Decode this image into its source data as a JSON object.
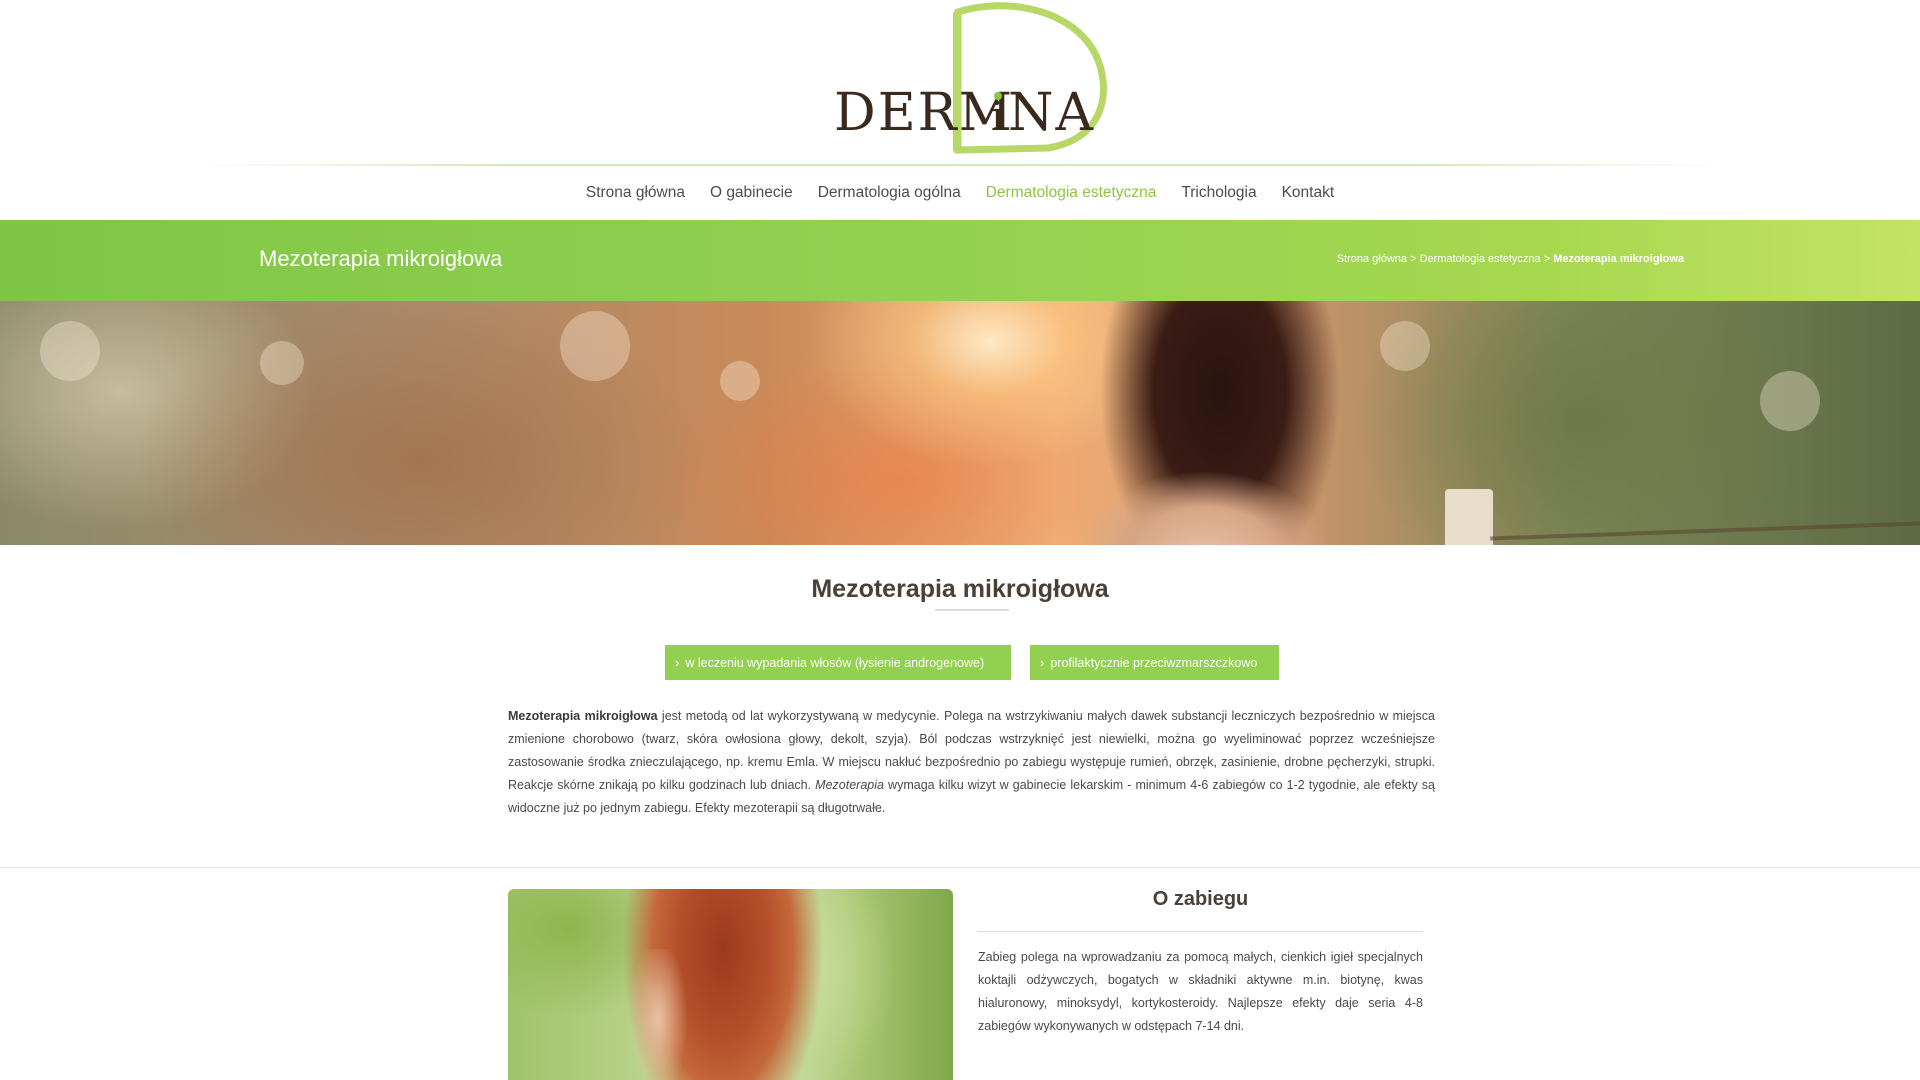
{
  "brand": {
    "logo_text": "DERMiNA",
    "accent_color": "#92d050",
    "text_color": "#3a2a1e"
  },
  "nav": {
    "items": [
      {
        "label": "Strona główna",
        "active": false
      },
      {
        "label": "O gabinecie",
        "active": false
      },
      {
        "label": "Dermatologia ogólna",
        "active": false
      },
      {
        "label": "Dermatologia estetyczna",
        "active": true
      },
      {
        "label": "Trichologia",
        "active": false
      },
      {
        "label": "Kontakt",
        "active": false
      }
    ]
  },
  "banner": {
    "title": "Mezoterapia mikroigłowa",
    "breadcrumb": {
      "home": "Strona główna",
      "separator1": " > ",
      "parent": "Dermatologia estetyczna",
      "separator2": " > ",
      "current": "Mezoterapia mikroigłowa"
    }
  },
  "main": {
    "title": "Mezoterapia mikroigłowa",
    "buttons": [
      {
        "label": "w leczeniu wypadania włosów (łysienie androgenowe)",
        "icon": "chevron-right-icon"
      },
      {
        "label": "profilaktycznie przeciwzmarszczkowo",
        "icon": "chevron-right-icon"
      }
    ],
    "intro": {
      "bold": "Mezoterapia mikroigłowa",
      "part1": " jest metodą od lat wykorzystywaną w medycynie. Polega na wstrzykiwaniu małych dawek substancji leczniczych bezpośrednio w miejsca zmienione chorobowo (twarz, skóra owłosiona głowy, dekolt, szyja). Ból podczas wstrzyknięć jest niewielki, można go wyeliminować poprzez wcześniejsze zastosowanie środka znieczulającego, np. kremu Emla. W miejscu nakłuć bezpośrednio po zabiegu występuje rumień, obrzęk, zasinienie, drobne pęcherzyki, strupki. Reakcje skórne znikają po kilku godzinach lub dniach. ",
      "italic": "Mezoterapia",
      "part2": " wymaga kilku wizyt w gabinecie lekarskim - minimum 4-6 zabiegów co 1-2 tygodnie, ale efekty są widoczne już po jednym zabiegu. Efekty mezoterapii są długotrwałe."
    }
  },
  "about": {
    "title": "O zabiegu",
    "text": "Zabieg polega na wprowadzaniu za pomocą małych, cienkich igieł specjalnych koktajli odżywczych, bogatych w składniki aktywne m.in. biotynę, kwas hialuronowy, minoksydyl, kortykosteroidy. Najlepsze efekty daje seria 4-8 zabiegów wykonywanych w odstępach 7-14 dni."
  }
}
